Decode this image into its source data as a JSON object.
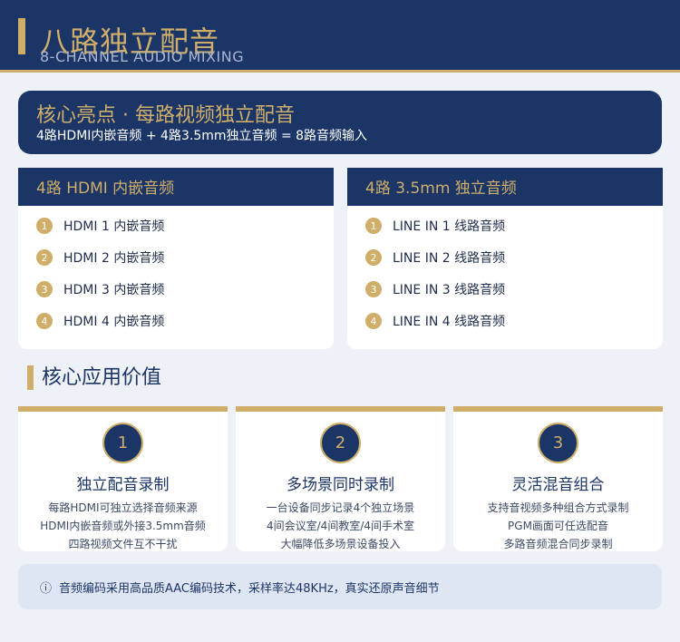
{
  "header": {
    "title": "八路独立配音",
    "subtitle": "8-CHANNEL AUDIO MIXING"
  },
  "highlight": {
    "title": "核心亮点 · 每路视频独立配音",
    "subtitle": "4路HDMI内嵌音频 + 4路3.5mm独立音频 = 8路音频输入"
  },
  "hdmi_panel": {
    "title": "4路 HDMI 内嵌音频",
    "items": [
      {
        "num": "1",
        "label": "HDMI 1 内嵌音频"
      },
      {
        "num": "2",
        "label": "HDMI 2 内嵌音频"
      },
      {
        "num": "3",
        "label": "HDMI 3 内嵌音频"
      },
      {
        "num": "4",
        "label": "HDMI 4 内嵌音频"
      }
    ]
  },
  "line_panel": {
    "title": "4路 3.5mm 独立音频",
    "items": [
      {
        "num": "1",
        "label": "LINE IN 1 线路音频"
      },
      {
        "num": "2",
        "label": "LINE IN 2 线路音频"
      },
      {
        "num": "3",
        "label": "LINE IN 3 线路音频"
      },
      {
        "num": "4",
        "label": "LINE IN 4 线路音频"
      }
    ]
  },
  "section": {
    "title": "核心应用价值"
  },
  "cards": [
    {
      "num": "1",
      "title": "独立配音录制",
      "lines": [
        "每路HDMI可独立选择音频来源",
        "HDMI内嵌音频或外接3.5mm音频",
        "四路视频文件互不干扰"
      ]
    },
    {
      "num": "2",
      "title": "多场景同时录制",
      "lines": [
        "一台设备同步记录4个独立场景",
        "4间会议室/4间教室/4间手术室",
        "大幅降低多场景设备投入"
      ]
    },
    {
      "num": "3",
      "title": "灵活混音组合",
      "lines": [
        "支持音视频多种组合方式录制",
        "PGM画面可任选配音",
        "多路音频混合同步录制"
      ]
    }
  ],
  "note": {
    "icon": "info-icon",
    "text": "音频编码采用高品质AAC编码技术，采样率达48KHz，真实还原声音细节"
  },
  "colors": {
    "navy": "#1c3567",
    "gold": "#cfae6a",
    "background": "#eef1f8"
  }
}
